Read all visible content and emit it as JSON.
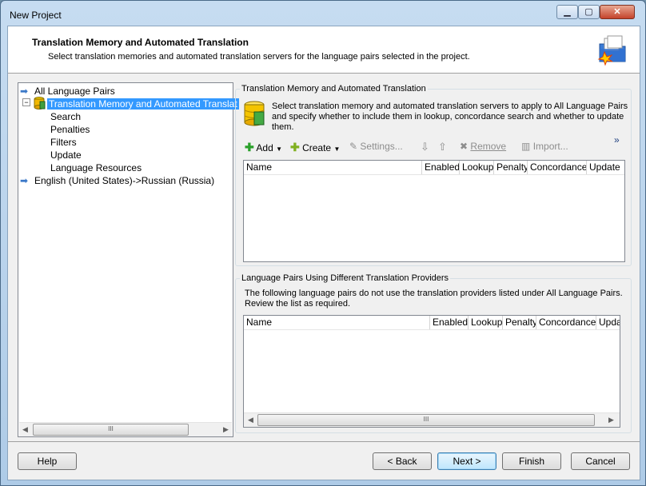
{
  "window": {
    "title": "New Project"
  },
  "header": {
    "title": "Translation Memory and Automated Translation",
    "subtitle": "Select translation memories and automated translation servers for the language pairs selected in the project."
  },
  "tree": {
    "items": [
      {
        "label": "All Language Pairs"
      },
      {
        "label": "Translation Memory and Automated Translat"
      },
      {
        "label": "Search"
      },
      {
        "label": "Penalties"
      },
      {
        "label": "Filters"
      },
      {
        "label": "Update"
      },
      {
        "label": "Language Resources"
      },
      {
        "label": "English (United States)->Russian (Russia)"
      }
    ],
    "scroll_mid": "III"
  },
  "tm_group": {
    "title": "Translation Memory and Automated Translation",
    "description_line1": "Select translation memory and automated translation servers to apply to All Language Pairs",
    "description_line2": "and specify whether to include them in lookup, concordance search and whether to update",
    "description_line3": "them.",
    "toolbar": {
      "add": "Add",
      "create": "Create",
      "settings": "Settings...",
      "remove": "Remove",
      "import": "Import...",
      "more": "»"
    },
    "columns": [
      "Name",
      "Enabled",
      "Lookup",
      "Penalty",
      "Concordance",
      "Update"
    ]
  },
  "lp_group": {
    "title": "Language Pairs Using Different Translation Providers",
    "description_line1": "The following language pairs do not use the translation providers listed under All Language Pairs.",
    "description_line2": "Review the list as required.",
    "columns": [
      "Name",
      "Enabled",
      "Lookup",
      "Penalty",
      "Concordance",
      "Upda"
    ],
    "scroll_mid": "III"
  },
  "footer": {
    "help": "Help",
    "back": "< Back",
    "next": "Next >",
    "finish": "Finish",
    "cancel": "Cancel"
  },
  "colors": {
    "selection": "#3399ff",
    "window_frame": "#aecbe7",
    "dialog_bg": "#f0f0f0"
  }
}
